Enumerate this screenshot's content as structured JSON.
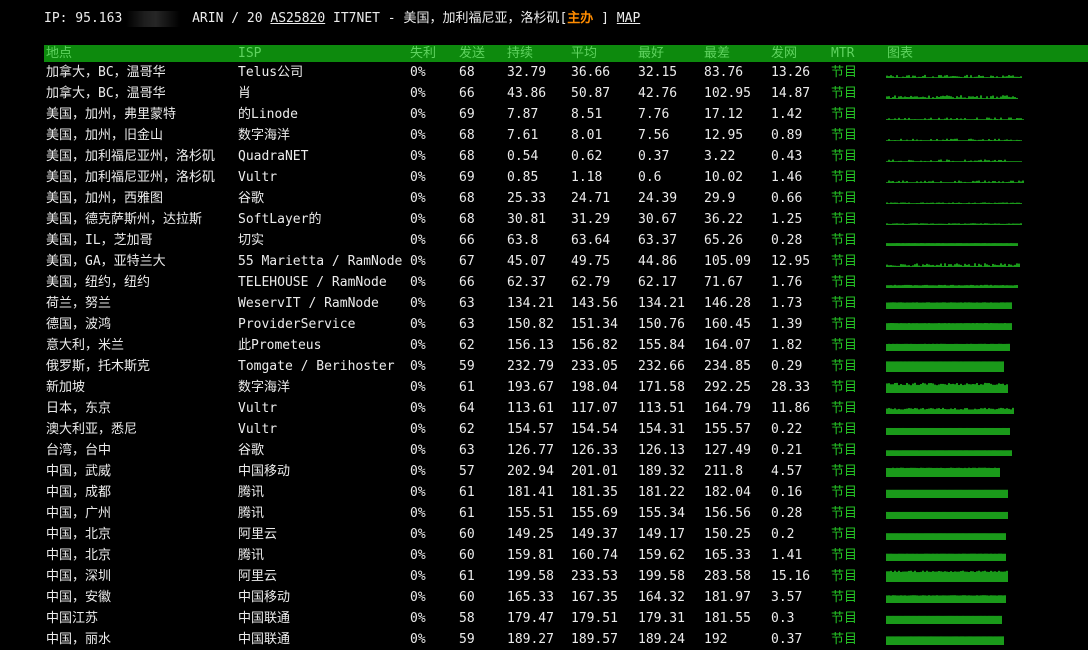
{
  "info": {
    "ip_label": "IP: 95.163",
    "net_text": "ARIN / 20",
    "asn": "AS25820",
    "desc": "IT7NET - 美国，加利福尼亚，洛杉矶[",
    "host": "主办",
    "bracket": "]",
    "map": "MAP"
  },
  "headers": {
    "loc": "地点",
    "isp": "ISP",
    "loss": "失利",
    "sent": "发送",
    "last": "持续",
    "avg": "平均",
    "best": "最好",
    "worst": "最差",
    "stdev": "发网",
    "mtr": "MTR",
    "graph": "图表"
  },
  "colors": {
    "header_bg": "#0d8a0d",
    "header_text": "#5fd35f",
    "graph": "#1a9a1a",
    "accent": "#ff8c00"
  },
  "rows": [
    {
      "loc": "加拿大，BC，温哥华",
      "isp": "Telus公司",
      "loss": "0%",
      "sent": "68",
      "last": "32.79",
      "avg": "36.66",
      "best": "32.15",
      "worst": "83.76",
      "stdev": "13.26",
      "mtr": "节目"
    },
    {
      "loc": "加拿大，BC，温哥华",
      "isp": "肖",
      "loss": "0%",
      "sent": "66",
      "last": "43.86",
      "avg": "50.87",
      "best": "42.76",
      "worst": "102.95",
      "stdev": "14.87",
      "mtr": "节目"
    },
    {
      "loc": "美国，加州，弗里蒙特",
      "isp": "的Linode",
      "loss": "0%",
      "sent": "69",
      "last": "7.87",
      "avg": "8.51",
      "best": "7.76",
      "worst": "17.12",
      "stdev": "1.42",
      "mtr": "节目"
    },
    {
      "loc": "美国，加州，旧金山",
      "isp": "数字海洋",
      "loss": "0%",
      "sent": "68",
      "last": "7.61",
      "avg": "8.01",
      "best": "7.56",
      "worst": "12.95",
      "stdev": "0.89",
      "mtr": "节目"
    },
    {
      "loc": "美国，加利福尼亚州，洛杉矶",
      "isp": "QuadraNET",
      "loss": "0%",
      "sent": "68",
      "last": "0.54",
      "avg": "0.62",
      "best": "0.37",
      "worst": "3.22",
      "stdev": "0.43",
      "mtr": "节目"
    },
    {
      "loc": "美国，加利福尼亚州，洛杉矶",
      "isp": "Vultr",
      "loss": "0%",
      "sent": "69",
      "last": "0.85",
      "avg": "1.18",
      "best": "0.6",
      "worst": "10.02",
      "stdev": "1.46",
      "mtr": "节目"
    },
    {
      "loc": "美国，加州，西雅图",
      "isp": "谷歌",
      "loss": "0%",
      "sent": "68",
      "last": "25.33",
      "avg": "24.71",
      "best": "24.39",
      "worst": "29.9",
      "stdev": "0.66",
      "mtr": "节目"
    },
    {
      "loc": "美国，德克萨斯州，达拉斯",
      "isp": "SoftLayer的",
      "loss": "0%",
      "sent": "68",
      "last": "30.81",
      "avg": "31.29",
      "best": "30.67",
      "worst": "36.22",
      "stdev": "1.25",
      "mtr": "节目"
    },
    {
      "loc": "美国，IL，芝加哥",
      "isp": "切实",
      "loss": "0%",
      "sent": "66",
      "last": "63.8",
      "avg": "63.64",
      "best": "63.37",
      "worst": "65.26",
      "stdev": "0.28",
      "mtr": "节目"
    },
    {
      "loc": "美国，GA，亚特兰大",
      "isp": "55 Marietta / RamNode",
      "loss": "0%",
      "sent": "67",
      "last": "45.07",
      "avg": "49.75",
      "best": "44.86",
      "worst": "105.09",
      "stdev": "12.95",
      "mtr": "节目"
    },
    {
      "loc": "美国，纽约，纽约",
      "isp": "TELEHOUSE / RamNode",
      "loss": "0%",
      "sent": "66",
      "last": "62.37",
      "avg": "62.79",
      "best": "62.17",
      "worst": "71.67",
      "stdev": "1.76",
      "mtr": "节目"
    },
    {
      "loc": "荷兰，努兰",
      "isp": "WeservIT / RamNode",
      "loss": "0%",
      "sent": "63",
      "last": "134.21",
      "avg": "143.56",
      "best": "134.21",
      "worst": "146.28",
      "stdev": "1.73",
      "mtr": "节目"
    },
    {
      "loc": "德国，波鸿",
      "isp": "ProviderService",
      "loss": "0%",
      "sent": "63",
      "last": "150.82",
      "avg": "151.34",
      "best": "150.76",
      "worst": "160.45",
      "stdev": "1.39",
      "mtr": "节目"
    },
    {
      "loc": "意大利，米兰",
      "isp": "此Prometeus",
      "loss": "0%",
      "sent": "62",
      "last": "156.13",
      "avg": "156.82",
      "best": "155.84",
      "worst": "164.07",
      "stdev": "1.82",
      "mtr": "节目"
    },
    {
      "loc": "俄罗斯，托木斯克",
      "isp": "Tomgate / Berihoster",
      "loss": "0%",
      "sent": "59",
      "last": "232.79",
      "avg": "233.05",
      "best": "232.66",
      "worst": "234.85",
      "stdev": "0.29",
      "mtr": "节目"
    },
    {
      "loc": "新加坡",
      "isp": "数字海洋",
      "loss": "0%",
      "sent": "61",
      "last": "193.67",
      "avg": "198.04",
      "best": "171.58",
      "worst": "292.25",
      "stdev": "28.33",
      "mtr": "节目"
    },
    {
      "loc": "日本，东京",
      "isp": "Vultr",
      "loss": "0%",
      "sent": "64",
      "last": "113.61",
      "avg": "117.07",
      "best": "113.51",
      "worst": "164.79",
      "stdev": "11.86",
      "mtr": "节目"
    },
    {
      "loc": "澳大利亚，悉尼",
      "isp": "Vultr",
      "loss": "0%",
      "sent": "62",
      "last": "154.57",
      "avg": "154.54",
      "best": "154.31",
      "worst": "155.57",
      "stdev": "0.22",
      "mtr": "节目"
    },
    {
      "loc": "台湾，台中",
      "isp": "谷歌",
      "loss": "0%",
      "sent": "63",
      "last": "126.77",
      "avg": "126.33",
      "best": "126.13",
      "worst": "127.49",
      "stdev": "0.21",
      "mtr": "节目"
    },
    {
      "loc": "中国，武威",
      "isp": "中国移动",
      "loss": "0%",
      "sent": "57",
      "last": "202.94",
      "avg": "201.01",
      "best": "189.32",
      "worst": "211.8",
      "stdev": "4.57",
      "mtr": "节目"
    },
    {
      "loc": "中国，成都",
      "isp": "腾讯",
      "loss": "0%",
      "sent": "61",
      "last": "181.41",
      "avg": "181.35",
      "best": "181.22",
      "worst": "182.04",
      "stdev": "0.16",
      "mtr": "节目"
    },
    {
      "loc": "中国，广州",
      "isp": "腾讯",
      "loss": "0%",
      "sent": "61",
      "last": "155.51",
      "avg": "155.69",
      "best": "155.34",
      "worst": "156.56",
      "stdev": "0.28",
      "mtr": "节目"
    },
    {
      "loc": "中国，北京",
      "isp": "阿里云",
      "loss": "0%",
      "sent": "60",
      "last": "149.25",
      "avg": "149.37",
      "best": "149.17",
      "worst": "150.25",
      "stdev": "0.2",
      "mtr": "节目"
    },
    {
      "loc": "中国，北京",
      "isp": "腾讯",
      "loss": "0%",
      "sent": "60",
      "last": "159.81",
      "avg": "160.74",
      "best": "159.62",
      "worst": "165.33",
      "stdev": "1.41",
      "mtr": "节目"
    },
    {
      "loc": "中国，深圳",
      "isp": "阿里云",
      "loss": "0%",
      "sent": "61",
      "last": "199.58",
      "avg": "233.53",
      "best": "199.58",
      "worst": "283.58",
      "stdev": "15.16",
      "mtr": "节目"
    },
    {
      "loc": "中国，安徽",
      "isp": "中国移动",
      "loss": "0%",
      "sent": "60",
      "last": "165.33",
      "avg": "167.35",
      "best": "164.32",
      "worst": "181.97",
      "stdev": "3.57",
      "mtr": "节目"
    },
    {
      "loc": "中国江苏",
      "isp": "中国联通",
      "loss": "0%",
      "sent": "58",
      "last": "179.47",
      "avg": "179.51",
      "best": "179.31",
      "worst": "181.55",
      "stdev": "0.3",
      "mtr": "节目"
    },
    {
      "loc": "中国，丽水",
      "isp": "中国联通",
      "loss": "0%",
      "sent": "59",
      "last": "189.27",
      "avg": "189.57",
      "best": "189.24",
      "worst": "192",
      "stdev": "0.37",
      "mtr": "节目"
    }
  ]
}
